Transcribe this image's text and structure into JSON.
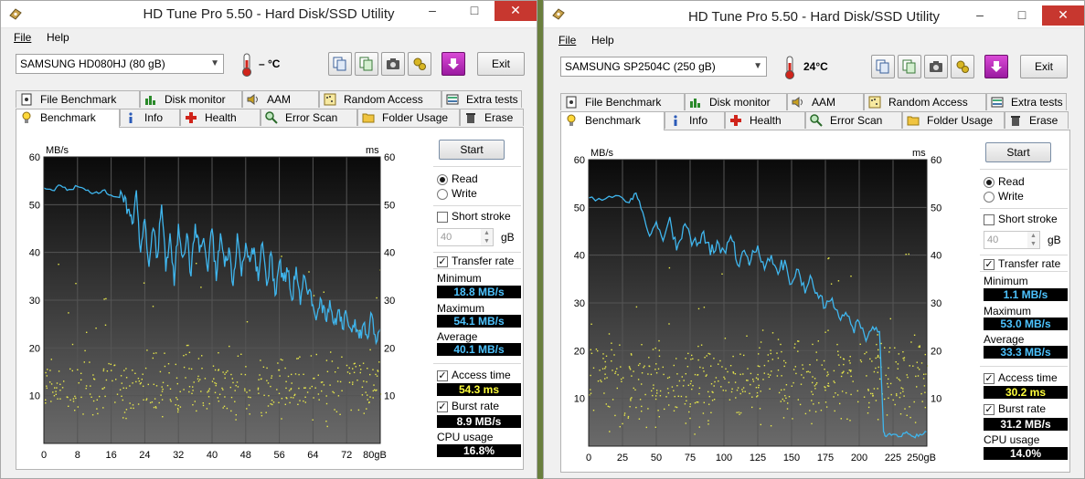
{
  "windows": [
    {
      "title": "HD Tune Pro 5.50 - Hard Disk/SSD Utility",
      "menu": [
        "File",
        "Help"
      ],
      "drive": "SAMSUNG HD080HJ (80 gB)",
      "temperature": "– °C",
      "exit_label": "Exit",
      "tabs_row1": [
        "File Benchmark",
        "Disk monitor",
        "AAM",
        "Random Access",
        "Extra tests"
      ],
      "tabs_row2": [
        "Benchmark",
        "Info",
        "Health",
        "Error Scan",
        "Folder Usage",
        "Erase"
      ],
      "start_label": "Start",
      "read_label": "Read",
      "write_label": "Write",
      "short_stroke_label": "Short stroke",
      "short_stroke_value": "40",
      "short_stroke_unit": "gB",
      "transfer_rate_label": "Transfer rate",
      "minimum_label": "Minimum",
      "minimum": "18.8 MB/s",
      "maximum_label": "Maximum",
      "maximum": "54.1 MB/s",
      "average_label": "Average",
      "average": "40.1 MB/s",
      "access_time_label": "Access time",
      "access_time": "54.3 ms",
      "burst_rate_label": "Burst rate",
      "burst_rate": "8.9 MB/s",
      "cpu_usage_label": "CPU usage",
      "cpu_usage": "16.8%"
    },
    {
      "title": "HD Tune Pro 5.50 - Hard Disk/SSD Utility",
      "menu": [
        "File",
        "Help"
      ],
      "drive": "SAMSUNG SP2504C (250 gB)",
      "temperature": "24°C",
      "exit_label": "Exit",
      "tabs_row1": [
        "File Benchmark",
        "Disk monitor",
        "AAM",
        "Random Access",
        "Extra tests"
      ],
      "tabs_row2": [
        "Benchmark",
        "Info",
        "Health",
        "Error Scan",
        "Folder Usage",
        "Erase"
      ],
      "start_label": "Start",
      "read_label": "Read",
      "write_label": "Write",
      "short_stroke_label": "Short stroke",
      "short_stroke_value": "40",
      "short_stroke_unit": "gB",
      "transfer_rate_label": "Transfer rate",
      "minimum_label": "Minimum",
      "minimum": "1.1 MB/s",
      "maximum_label": "Maximum",
      "maximum": "53.0 MB/s",
      "average_label": "Average",
      "average": "33.3 MB/s",
      "access_time_label": "Access time",
      "access_time": "30.2 ms",
      "burst_rate_label": "Burst rate",
      "burst_rate": "31.2 MB/s",
      "cpu_usage_label": "CPU usage",
      "cpu_usage": "14.0%"
    }
  ],
  "chart_data": [
    {
      "type": "line",
      "left_unit": "MB/s",
      "right_unit": "ms",
      "y_ticks": [
        10,
        20,
        30,
        40,
        50,
        60
      ],
      "ylim": [
        0,
        60
      ],
      "x_ticks": [
        "0",
        "8",
        "16",
        "24",
        "32",
        "40",
        "48",
        "56",
        "64",
        "72",
        "80gB"
      ],
      "xlim": [
        0,
        80
      ],
      "series": [
        {
          "kind": "transfer_rate",
          "color": "#3fb6ee",
          "x": [
            0,
            2,
            4,
            6,
            8,
            10,
            12,
            14,
            16,
            18,
            19,
            20,
            21,
            22,
            23,
            24,
            25,
            26,
            27,
            28,
            29,
            30,
            31,
            32,
            33,
            34,
            35,
            36,
            37,
            38,
            39,
            40,
            41,
            42,
            43,
            44,
            45,
            46,
            47,
            48,
            49,
            50,
            51,
            52,
            53,
            54,
            55,
            56,
            57,
            58,
            59,
            60,
            61,
            62,
            63,
            64,
            65,
            66,
            67,
            68,
            69,
            70,
            71,
            72,
            73,
            74,
            75,
            76,
            77,
            78,
            79,
            80
          ],
          "y": [
            53.5,
            53,
            54,
            53.2,
            53.8,
            53,
            52.5,
            53,
            52,
            51.5,
            50.5,
            49,
            46,
            53,
            40,
            47,
            37,
            45,
            39,
            50,
            36,
            44,
            33,
            46,
            39,
            44,
            35,
            46,
            40,
            43,
            36,
            45,
            34,
            44,
            37,
            41,
            33,
            44,
            35,
            42,
            38,
            41,
            34,
            42,
            33,
            40,
            31,
            38,
            34,
            36,
            30,
            37,
            29,
            35,
            32,
            29,
            27,
            30,
            26,
            30,
            25,
            28,
            24,
            27,
            24,
            26,
            22,
            25,
            22,
            27,
            21,
            24
          ]
        },
        {
          "kind": "access_time",
          "color": "#e8e84a",
          "style": "scatter",
          "points_per_x": "random scatter roughly between 5 and 20 ms, denser around 10-16 ms"
        }
      ]
    },
    {
      "type": "line",
      "left_unit": "MB/s",
      "right_unit": "ms",
      "y_ticks": [
        10,
        20,
        30,
        40,
        50,
        60
      ],
      "ylim": [
        0,
        60
      ],
      "x_ticks": [
        "0",
        "25",
        "50",
        "75",
        "100",
        "125",
        "150",
        "175",
        "200",
        "225",
        "250gB"
      ],
      "xlim": [
        0,
        250
      ],
      "series": [
        {
          "kind": "transfer_rate",
          "color": "#3fb6ee",
          "x": [
            0,
            10,
            20,
            30,
            35,
            40,
            45,
            50,
            55,
            60,
            65,
            70,
            75,
            80,
            85,
            90,
            95,
            100,
            105,
            110,
            115,
            120,
            125,
            130,
            135,
            140,
            145,
            150,
            155,
            160,
            165,
            170,
            175,
            180,
            185,
            190,
            195,
            200,
            205,
            210,
            215,
            218,
            220,
            225,
            230,
            235,
            240,
            245,
            250
          ],
          "y": [
            52,
            51.5,
            52.5,
            51,
            53,
            49,
            44,
            47,
            43,
            48,
            41,
            46,
            44,
            42,
            45,
            40,
            43,
            41,
            44,
            38,
            41,
            39,
            42,
            37,
            40,
            36,
            39,
            34,
            37,
            32,
            35,
            31,
            29,
            31,
            27,
            28,
            25,
            26,
            22,
            25,
            24,
            3,
            2,
            2.5,
            2,
            3,
            2,
            2.5,
            3
          ]
        },
        {
          "kind": "access_time",
          "color": "#e8e84a",
          "style": "scatter",
          "points_per_x": "random scatter roughly between 5 and 25 ms, denser around 10-18 ms"
        }
      ]
    }
  ]
}
